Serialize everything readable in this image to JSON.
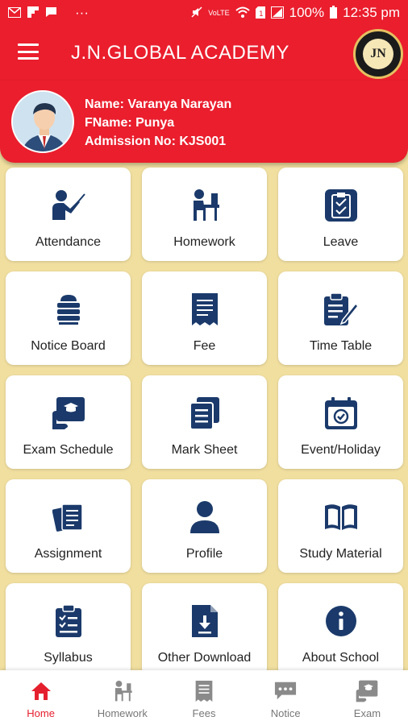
{
  "status_bar": {
    "left_icons": [
      "gmail-icon",
      "flipboard-icon",
      "message-icon"
    ],
    "more": "···",
    "network": "VoLTE",
    "battery": "100%",
    "time": "12:35 pm"
  },
  "header": {
    "title": "J.N.GLOBAL ACADEMY",
    "logo_text": "JN"
  },
  "profile": {
    "name_line": "Name: Varanya Narayan",
    "fname_line": "FName: Punya",
    "admission_line": "Admission No: KJS001"
  },
  "menu": [
    {
      "label": "Attendance",
      "icon": "teacher-icon"
    },
    {
      "label": "Homework",
      "icon": "student-desk-icon"
    },
    {
      "label": "Leave",
      "icon": "leave-clipboard-icon"
    },
    {
      "label": "Notice Board",
      "icon": "notice-stack-icon"
    },
    {
      "label": "Fee",
      "icon": "receipt-icon"
    },
    {
      "label": "Time Table",
      "icon": "clipboard-pen-icon"
    },
    {
      "label": "Exam Schedule",
      "icon": "exam-certificate-icon"
    },
    {
      "label": "Mark Sheet",
      "icon": "documents-icon"
    },
    {
      "label": "Event/Holiday",
      "icon": "calendar-check-icon"
    },
    {
      "label": "Assignment",
      "icon": "assignment-papers-icon"
    },
    {
      "label": "Profile",
      "icon": "person-icon"
    },
    {
      "label": "Study Material",
      "icon": "open-book-icon"
    },
    {
      "label": "Syllabus",
      "icon": "checklist-icon"
    },
    {
      "label": "Other Download",
      "icon": "file-download-icon"
    },
    {
      "label": "About School",
      "icon": "info-icon"
    }
  ],
  "bottom_nav": [
    {
      "label": "Home",
      "icon": "home-icon",
      "active": true
    },
    {
      "label": "Homework",
      "icon": "student-desk-icon",
      "active": false
    },
    {
      "label": "Fees",
      "icon": "receipt-icon",
      "active": false
    },
    {
      "label": "Notice",
      "icon": "chat-icon",
      "active": false
    },
    {
      "label": "Exam",
      "icon": "exam-certificate-icon",
      "active": false
    }
  ],
  "colors": {
    "primary_red": "#ea1e2d",
    "icon_navy": "#1b3a6b",
    "background_gold": "#f1dfa0",
    "nav_active": "#e5202e",
    "nav_inactive": "#777777"
  }
}
